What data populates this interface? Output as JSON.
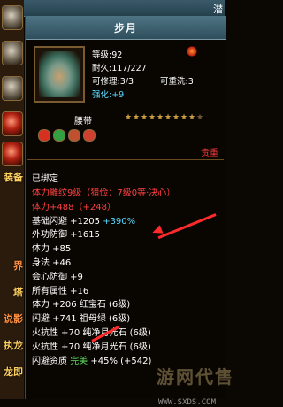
{
  "top_bar": {
    "right_label": "潜"
  },
  "left_strip": {
    "labels": [
      "装备",
      "界",
      "塔",
      "说影",
      "执龙",
      "龙即"
    ],
    "label_colors": [
      "#ffd060",
      "#ff9040",
      "#ffd060",
      "#ff9040",
      "#ffd060",
      "#ffd060"
    ]
  },
  "item": {
    "name": "步月",
    "level_line": "等级:92",
    "durability_line": "耐久:117/227",
    "repair_line": "可修理:3/3",
    "rewash_line": "可重洗:3",
    "enhance_label": "强化:",
    "enhance_value": "+9",
    "type": "腰带",
    "stars_total": 10,
    "stars_filled": 9,
    "rarity": "贵重",
    "socket_colors": [
      "#d83020",
      "#30a040",
      "#c05030",
      "#d04030"
    ]
  },
  "bind_status": "已绑定",
  "properties": [
    {
      "text": "体力雕纹9级（猎俭：7级0等·决心）",
      "color": "red"
    },
    {
      "text": "体力+488（+248）",
      "color": "red"
    },
    {
      "parts": [
        {
          "text": "基础闪避 +1205 ",
          "color": "white"
        },
        {
          "text": "+390%",
          "color": "cyan"
        }
      ]
    },
    {
      "parts": [
        {
          "text": "外功防御 +1615",
          "color": "white"
        }
      ]
    },
    {
      "parts": [
        {
          "text": "体力 +85",
          "color": "white"
        }
      ]
    },
    {
      "parts": [
        {
          "text": "身法 +46",
          "color": "white"
        }
      ]
    },
    {
      "parts": [
        {
          "text": "会心防御 +9",
          "color": "white"
        }
      ]
    },
    {
      "parts": [
        {
          "text": "所有属性 +16",
          "color": "white"
        }
      ]
    },
    {
      "parts": [
        {
          "text": "体力 +206 红宝石 (6级)",
          "color": "white"
        }
      ]
    },
    {
      "parts": [
        {
          "text": "闪避 +741 祖母绿 (6级)",
          "color": "white"
        }
      ]
    },
    {
      "parts": [
        {
          "text": "火抗性 +70 纯净月光石 (6级)",
          "color": "white"
        }
      ]
    },
    {
      "parts": [
        {
          "text": "火抗性 +70 纯净月光石 (6级)",
          "color": "white"
        }
      ]
    },
    {
      "parts": [
        {
          "text": "闪避资质 ",
          "color": "white"
        },
        {
          "text": "完美",
          "color": "green"
        },
        {
          "text": " +45% (+542)",
          "color": "white"
        }
      ]
    }
  ],
  "watermark": {
    "text": "游网代售",
    "url": "WWW.SXDS.COM"
  }
}
